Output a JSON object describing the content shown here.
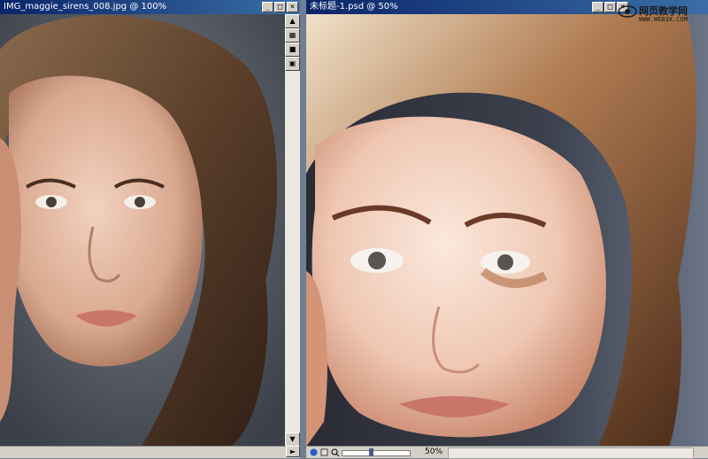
{
  "left_window": {
    "title": "IMG_maggie_sirens_008.jpg @ 100%",
    "controls": {
      "minimize": "_",
      "maximize": "□",
      "close": "×"
    }
  },
  "right_window": {
    "title": "未标题-1.psd @ 50%",
    "controls": {
      "minimize": "_",
      "maximize": "□",
      "close": "×"
    },
    "status": {
      "zoom": "50%"
    }
  },
  "watermark": {
    "line1": "网页教学网",
    "line2": "WWW.WEB3X.COM"
  },
  "colors": {
    "titlebar": "#0a246a",
    "chrome": "#d4d0c8"
  }
}
